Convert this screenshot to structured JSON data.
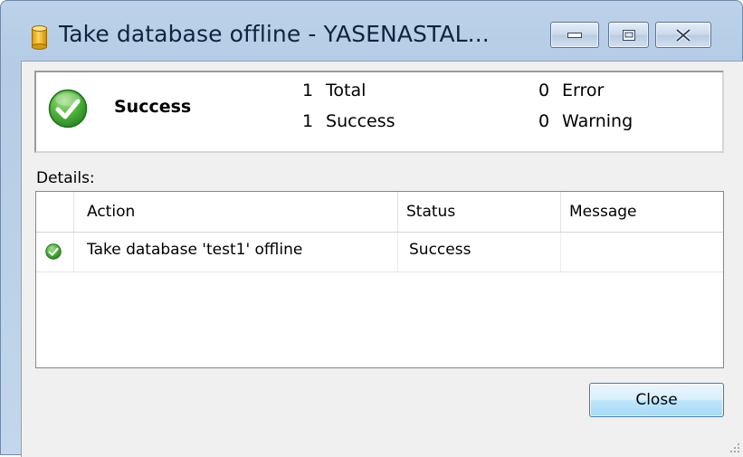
{
  "window": {
    "title": "Take database offline - YASENASTAL...",
    "icons": {
      "app": "database-cylinder-icon",
      "minimize": "minimize-icon",
      "maximize": "maximize-icon",
      "close": "close-x-icon"
    }
  },
  "summary": {
    "status_icon": "success-check-icon",
    "status_label": "Success",
    "total_count": "1",
    "total_label": "Total",
    "success_count": "1",
    "success_label": "Success",
    "error_count": "0",
    "error_label": "Error",
    "warning_count": "0",
    "warning_label": "Warning"
  },
  "details": {
    "label": "Details:",
    "columns": [
      "Action",
      "Status",
      "Message"
    ],
    "rows": [
      {
        "icon": "success-check-icon",
        "action": "Take database 'test1' offline",
        "status": "Success",
        "message": ""
      }
    ]
  },
  "buttons": {
    "close_label": "Close"
  },
  "colors": {
    "titlebar": "#b9cfe8",
    "success_green": "#3aa83a",
    "client_bg": "#f0f0f0",
    "button_border": "#3c7fb1"
  }
}
